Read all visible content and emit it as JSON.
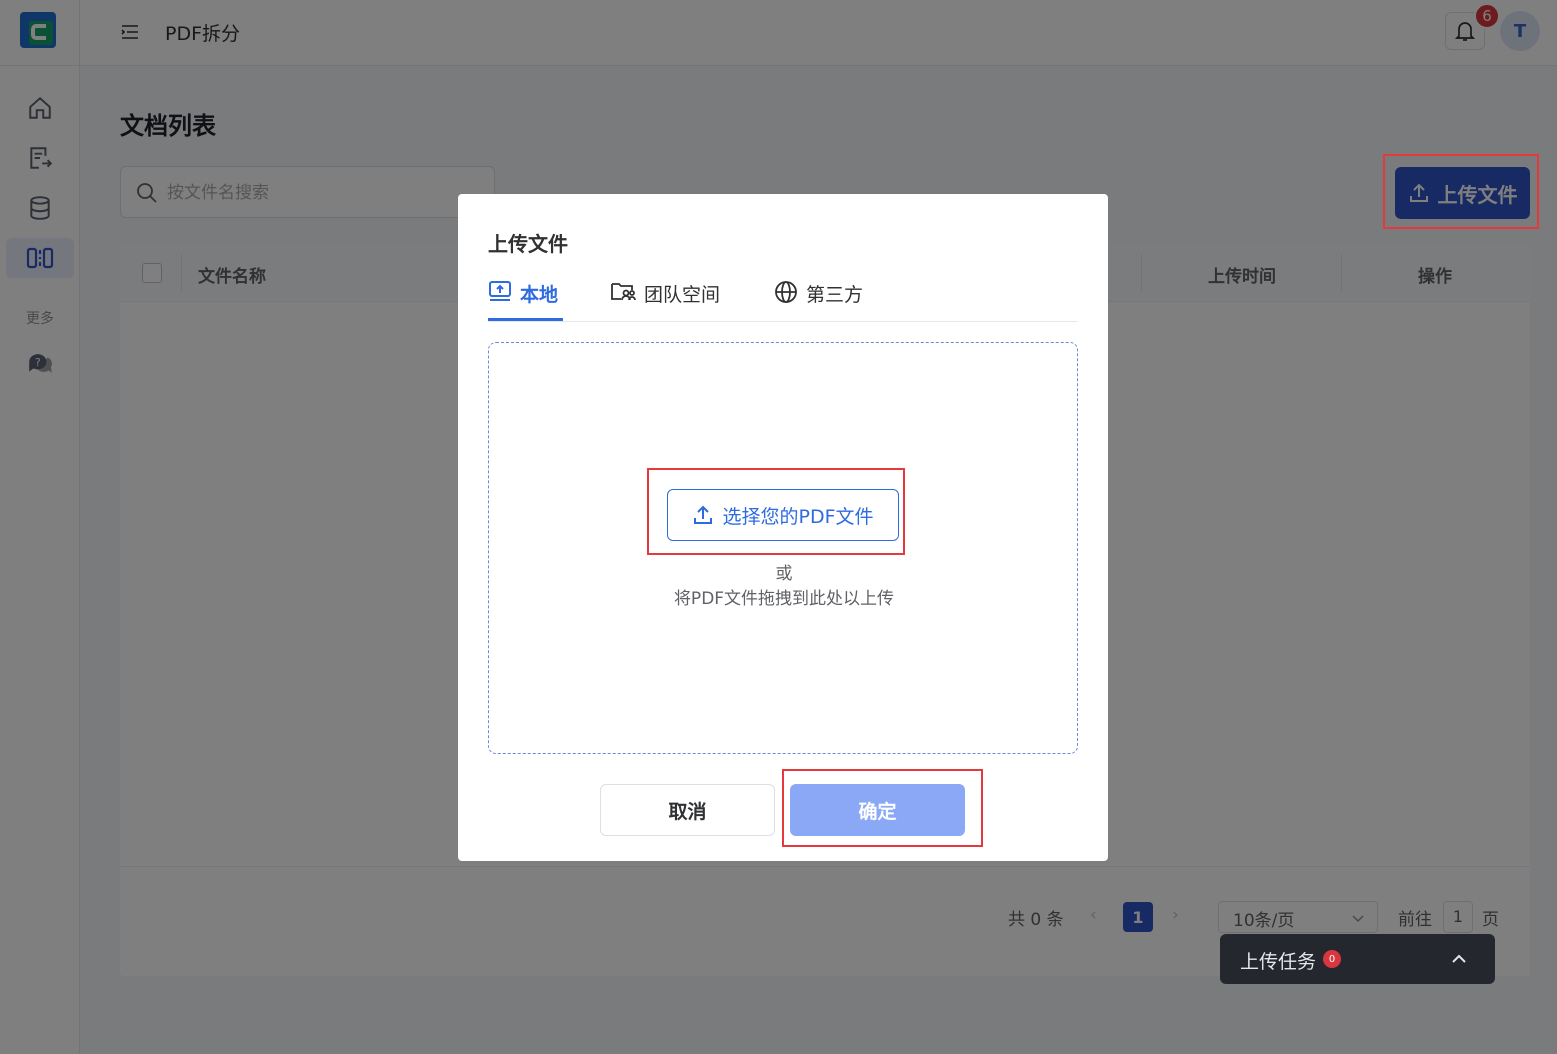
{
  "header": {
    "title": "PDF拆分",
    "notification_count": "6",
    "avatar_initial": "T"
  },
  "sidebar": {
    "items": [
      {
        "name": "home",
        "icon": "home-icon",
        "active": false
      },
      {
        "name": "document-export",
        "icon": "document-export-icon",
        "active": false
      },
      {
        "name": "database",
        "icon": "database-icon",
        "active": false
      },
      {
        "name": "split",
        "icon": "split-icon",
        "active": true
      }
    ],
    "more_label": "更多",
    "support_icon": "chat-question-icon"
  },
  "page": {
    "title": "文档列表",
    "search_placeholder": "按文件名搜索",
    "upload_button_label": "上传文件"
  },
  "table": {
    "columns": [
      "文件名称",
      "上传时间",
      "操作"
    ],
    "rows": []
  },
  "pagination": {
    "total_label": "共 0 条",
    "current_page": "1",
    "prev": "‹",
    "next": "›",
    "page_size": "10条/页",
    "goto_label": "前往",
    "goto_value": "1",
    "goto_suffix": "页"
  },
  "modal": {
    "title": "上传文件",
    "tabs": [
      {
        "label": "本地",
        "icon": "upload-screen-icon",
        "active": true
      },
      {
        "label": "团队空间",
        "icon": "team-folder-icon",
        "active": false
      },
      {
        "label": "第三方",
        "icon": "globe-icon",
        "active": false
      }
    ],
    "choose_button_label": "选择您的PDF文件",
    "or_text": "或",
    "drop_hint": "将PDF文件拖拽到此处以上传",
    "cancel_label": "取消",
    "confirm_label": "确定"
  },
  "upload_tasks": {
    "label": "上传任务",
    "count": "0"
  },
  "colors": {
    "primary": "#2f54c7",
    "accent_blue": "#2f6be0",
    "confirm_disabled": "#8aa8f6",
    "highlight_red": "#e5393d",
    "badge_red": "#d9373f"
  }
}
